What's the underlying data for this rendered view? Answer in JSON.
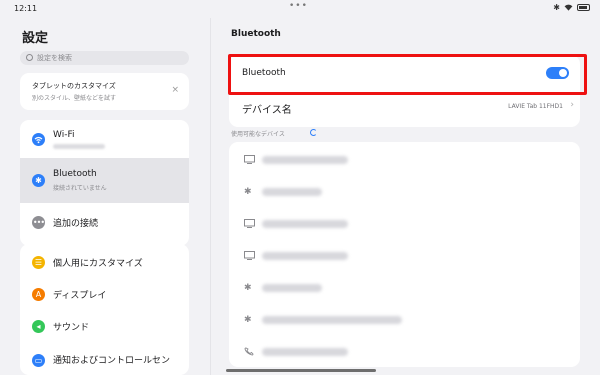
{
  "status": {
    "time": "12:11",
    "center_dots": "•••"
  },
  "left": {
    "title": "設定",
    "search_placeholder": "設定を検索",
    "promo": {
      "title": "タブレットのカスタマイズ",
      "subtitle": "別のスタイル、壁紙などを試す",
      "close": "×"
    },
    "group1": [
      {
        "label": "Wi-Fi",
        "sub": "",
        "icon": "wifi-icon",
        "color": "#2d7ff9"
      },
      {
        "label": "Bluetooth",
        "sub": "接続されていません",
        "icon": "bluetooth-icon",
        "color": "#2d7ff9",
        "selected": true
      },
      {
        "label": "追加の接続",
        "sub": "",
        "icon": "more-dots-icon",
        "color": "#8e8e93"
      }
    ],
    "group2": [
      {
        "label": "個人用にカスタマイズ",
        "icon": "personalize-icon",
        "color": "#f4b400"
      },
      {
        "label": "ディスプレイ",
        "icon": "display-icon",
        "color": "#f57c00"
      },
      {
        "label": "サウンド",
        "icon": "sound-icon",
        "color": "#34c759"
      },
      {
        "label": "通知およびコントロールセン",
        "icon": "notification-icon",
        "color": "#2d7ff9"
      }
    ]
  },
  "right": {
    "title": "Bluetooth",
    "bluetooth_label": "Bluetooth",
    "bluetooth_on": true,
    "device_name_label": "デバイス名",
    "device_name_value": "LAVIE Tab 11FHD1",
    "available_header": "使用可能なデバイス",
    "devices": [
      {
        "icon": "monitor-icon"
      },
      {
        "icon": "bluetooth-icon"
      },
      {
        "icon": "monitor-icon"
      },
      {
        "icon": "monitor-icon"
      },
      {
        "icon": "bluetooth-icon"
      },
      {
        "icon": "bluetooth-icon"
      },
      {
        "icon": "phone-icon"
      }
    ]
  },
  "colors": {
    "accent": "#2d7ff9",
    "highlight": "#e11111"
  }
}
